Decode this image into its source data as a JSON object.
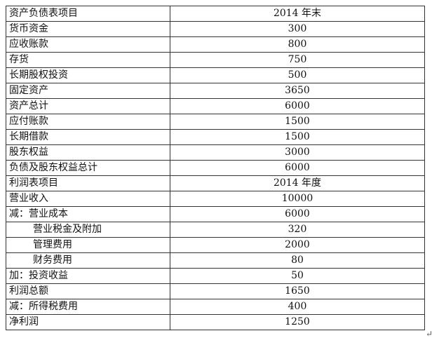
{
  "table": {
    "rows": [
      {
        "label": "资产负债表项目",
        "value": "2014 年末",
        "indent": false
      },
      {
        "label": "货币资金",
        "value": "300",
        "indent": false
      },
      {
        "label": "应收账款",
        "value": "800",
        "indent": false
      },
      {
        "label": "存货",
        "value": "750",
        "indent": false
      },
      {
        "label": "长期股权投资",
        "value": "500",
        "indent": false
      },
      {
        "label": "固定资产",
        "value": "3650",
        "indent": false
      },
      {
        "label": "资产总计",
        "value": "6000",
        "indent": false
      },
      {
        "label": "应付账款",
        "value": "1500",
        "indent": false
      },
      {
        "label": "长期借款",
        "value": "1500",
        "indent": false
      },
      {
        "label": "股东权益",
        "value": "3000",
        "indent": false
      },
      {
        "label": "负债及股东权益总计",
        "value": "6000",
        "indent": false
      },
      {
        "label": "利润表项目",
        "value": "2014 年度",
        "indent": false
      },
      {
        "label": "营业收入",
        "value": "10000",
        "indent": false
      },
      {
        "label": "减：营业成本",
        "value": "6000",
        "indent": false
      },
      {
        "label": "营业税金及附加",
        "value": "320",
        "indent": true
      },
      {
        "label": "管理费用",
        "value": "2000",
        "indent": true
      },
      {
        "label": "财务费用",
        "value": "80",
        "indent": true
      },
      {
        "label": "加：投资收益",
        "value": "50",
        "indent": false
      },
      {
        "label": "利润总额",
        "value": "1650",
        "indent": false
      },
      {
        "label": "减：所得税费用",
        "value": "400",
        "indent": false
      },
      {
        "label": "净利润",
        "value": "1250",
        "indent": false
      }
    ]
  },
  "paragraph_mark": "↵"
}
